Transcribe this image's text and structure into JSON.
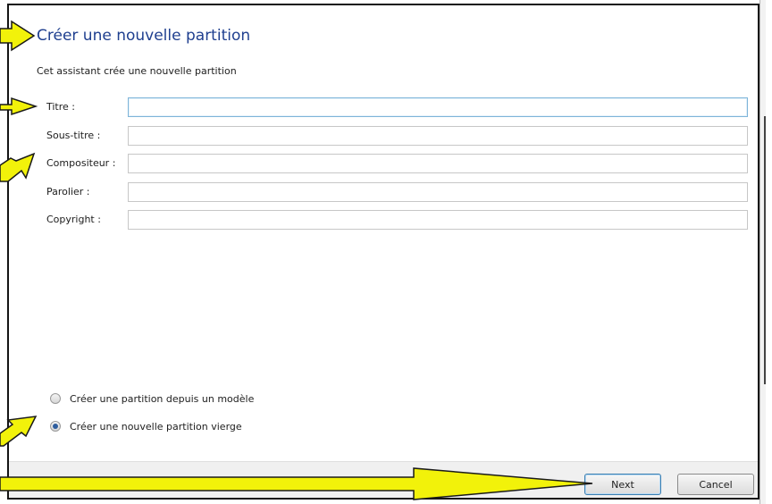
{
  "dialog": {
    "title": "Créer une nouvelle partition",
    "description": "Cet assistant crée une nouvelle partition"
  },
  "fields": [
    {
      "label": "Titre :",
      "value": ""
    },
    {
      "label": "Sous-titre :",
      "value": ""
    },
    {
      "label": "Compositeur :",
      "value": ""
    },
    {
      "label": "Parolier :",
      "value": ""
    },
    {
      "label": "Copyright :",
      "value": ""
    }
  ],
  "options": [
    {
      "label": "Créer une partition depuis un modèle",
      "checked": false
    },
    {
      "label": "Créer une nouvelle partition vierge",
      "checked": true
    }
  ],
  "buttons": {
    "next": "Next",
    "cancel": "Cancel"
  },
  "colors": {
    "title": "#1f3f8f",
    "callout_fill": "#f2f20a",
    "callout_stroke": "#1a1a1a"
  }
}
